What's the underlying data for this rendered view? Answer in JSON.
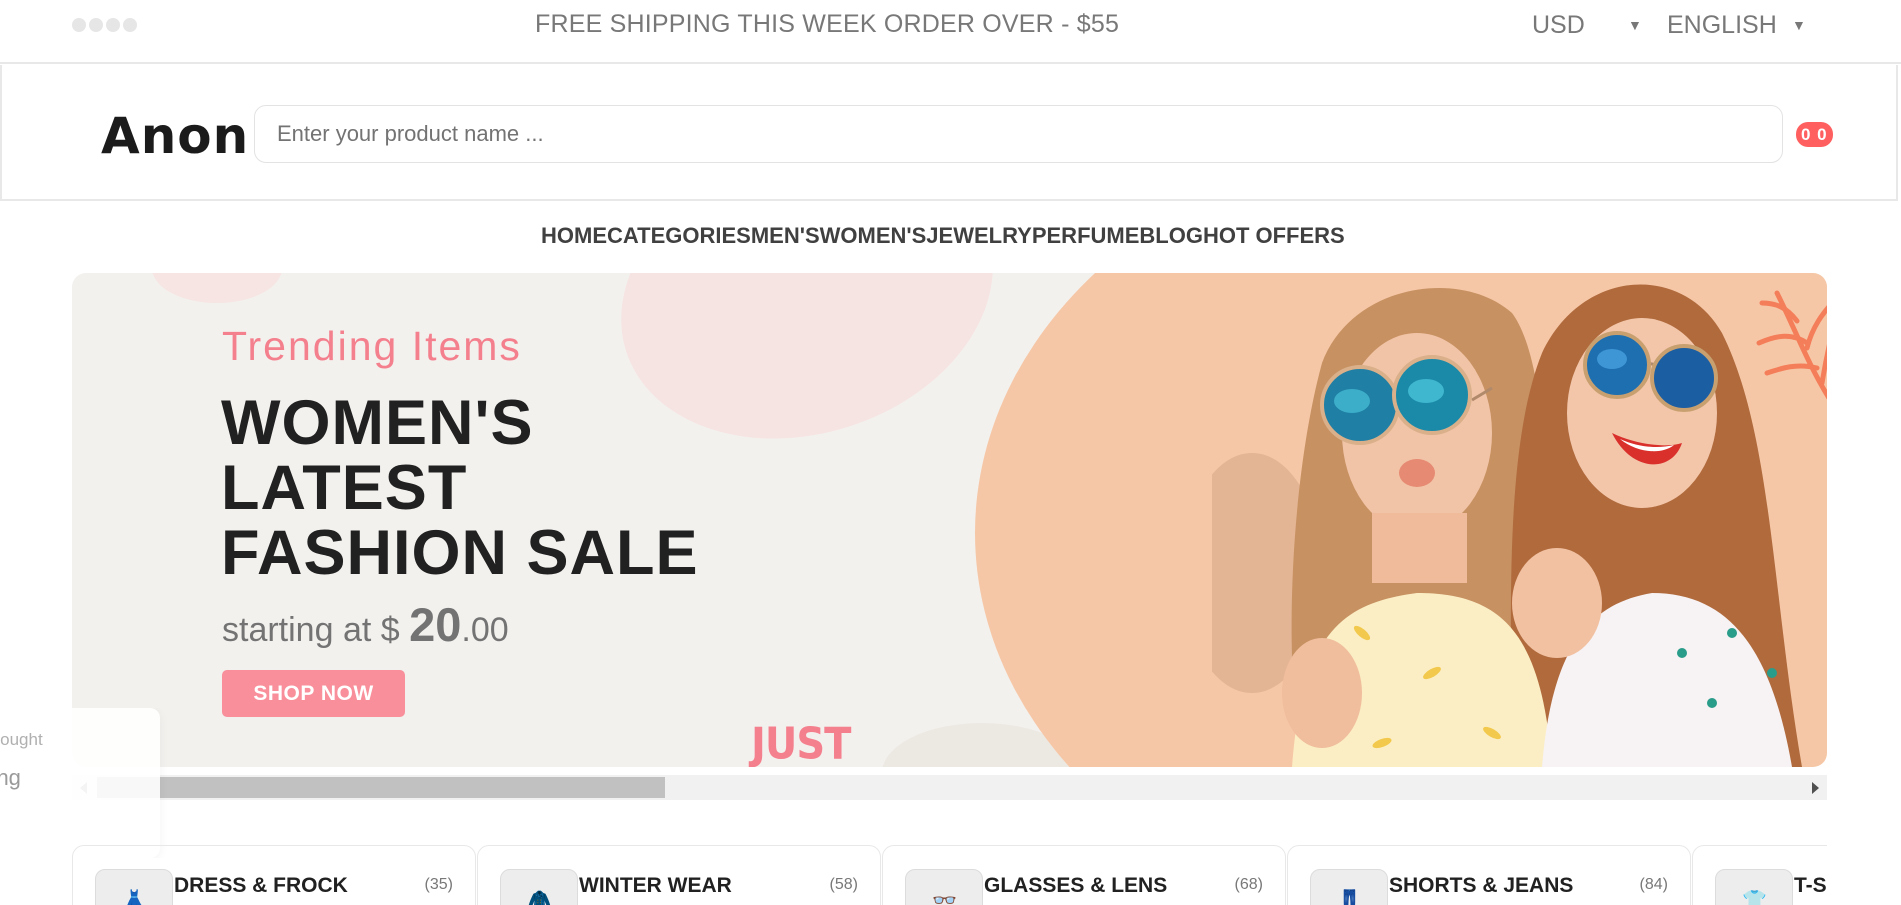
{
  "topbar": {
    "social_icons": [
      "facebook-icon",
      "twitter-icon",
      "instagram-icon",
      "linkedin-icon"
    ],
    "announcement": "FREE SHIPPING THIS WEEK ORDER OVER - $55",
    "currency": "USD",
    "language": "ENGLISH"
  },
  "header": {
    "logo": "Anon",
    "search_placeholder": "Enter your product name ...",
    "cart_badge": "0 0"
  },
  "nav": {
    "items": [
      "HOME",
      "CATEGORIES",
      "MEN'S",
      "WOMEN'S",
      "JEWELRY",
      "PERFUME",
      "BLOG",
      "HOT OFFERS"
    ]
  },
  "banner": {
    "subtitle": "Trending Items",
    "title": "WOMEN'S LATEST FASHION SALE",
    "price_prefix": "starting at $ ",
    "price_whole": "20",
    "price_cents": ".00",
    "button": "SHOP NOW",
    "decor_text": "JUST",
    "colors": {
      "accent": "#f88f9a",
      "background": "#f3f1ee",
      "peach": "#f6c7a6"
    }
  },
  "toast": {
    "line1": "Someone just bought",
    "line2": "Earring"
  },
  "categories": [
    {
      "name": "DRESS & FROCK",
      "count": "(35)",
      "icon": "dress-icon"
    },
    {
      "name": "WINTER WEAR",
      "count": "(58)",
      "icon": "coat-icon"
    },
    {
      "name": "GLASSES & LENS",
      "count": "(68)",
      "icon": "glasses-icon"
    },
    {
      "name": "SHORTS & JEANS",
      "count": "(84)",
      "icon": "jeans-icon"
    },
    {
      "name": "T-SHIRTS",
      "count": "",
      "icon": "tshirt-icon"
    }
  ]
}
